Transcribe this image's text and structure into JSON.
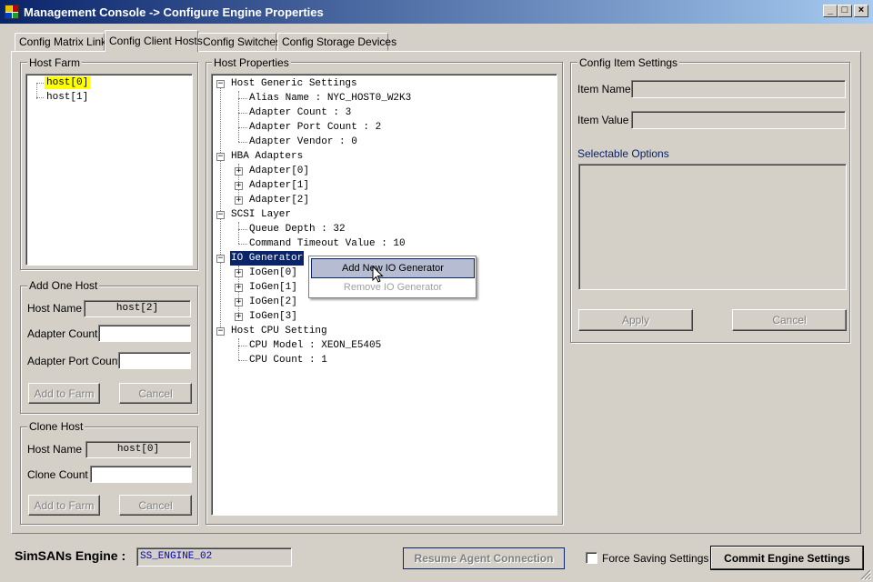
{
  "window": {
    "title": "Management Console -> Configure Engine Properties",
    "buttons": {
      "minimize": "_",
      "maximize": "□",
      "close": "×"
    }
  },
  "tabs": [
    {
      "label": "Config Matrix Links",
      "active": false
    },
    {
      "label": "Config Client Hosts",
      "active": true
    },
    {
      "label": "Config Switches",
      "active": false
    },
    {
      "label": "Config Storage Devices",
      "active": false
    }
  ],
  "host_farm": {
    "title": "Host Farm",
    "hosts": [
      "host[0]",
      "host[1]"
    ],
    "selected_index": 0,
    "highlight_color": "#ffff00"
  },
  "add_one_host": {
    "title": "Add One Host",
    "host_name_label": "Host Name",
    "host_name_value": "host[2]",
    "adapter_count_label": "Adapter Count",
    "adapter_count_value": "",
    "adapter_port_count_label": "Adapter Port Count",
    "adapter_port_count_value": "",
    "add_button": "Add to Farm",
    "cancel_button": "Cancel"
  },
  "clone_host": {
    "title": "Clone Host",
    "host_name_label": "Host Name",
    "host_name_value": "host[0]",
    "clone_count_label": "Clone Count",
    "clone_count_value": "",
    "add_button": "Add to Farm",
    "cancel_button": "Cancel"
  },
  "host_properties": {
    "title": "Host Properties",
    "generic_settings": {
      "label": "Host Generic Settings",
      "alias": "Alias Name : NYC_HOST0_W2K3",
      "adapter_count": "Adapter Count : 3",
      "adapter_port_count": "Adapter Port Count : 2",
      "adapter_vendor": "Adapter Vendor : 0"
    },
    "hba_adapters": {
      "label": "HBA Adapters",
      "items": [
        "Adapter[0]",
        "Adapter[1]",
        "Adapter[2]"
      ]
    },
    "scsi_layer": {
      "label": "SCSI Layer",
      "queue_depth": "Queue Depth : 32",
      "command_timeout": "Command Timeout Value : 10"
    },
    "io_generator": {
      "label": "IO Generator",
      "items": [
        "IoGen[0]",
        "IoGen[1]",
        "IoGen[2]",
        "IoGen[3]"
      ]
    },
    "cpu_setting": {
      "label": "Host CPU Setting",
      "cpu_model": "CPU Model : XEON_E5405",
      "cpu_count": "CPU Count : 1"
    },
    "expander_collapsed": "+",
    "expander_expanded": "−"
  },
  "context_menu": {
    "add": "Add New IO Generator",
    "remove": "Remove IO Generator"
  },
  "config_item": {
    "title": "Config Item Settings",
    "item_name_label": "Item Name",
    "item_name_value": "",
    "item_value_label": "Item Value",
    "item_value_value": "",
    "selectable_options_label": "Selectable Options",
    "apply_button": "Apply",
    "cancel_button": "Cancel"
  },
  "footer": {
    "engine_label": "SimSANs Engine :",
    "engine_value": "SS_ENGINE_02",
    "resume_button": "Resume Agent Connection",
    "force_saving_label": "Force Saving Settings",
    "force_saving_checked": false,
    "commit_button": "Commit Engine Settings"
  },
  "colors": {
    "title_bar_start": "#0a246a",
    "title_bar_end": "#a6caf0",
    "selection_navy": "#0a246a",
    "link_blue": "#0a246a",
    "engine_text": "#0000c0",
    "menu_hover": "#b6bdd2"
  },
  "icons": [
    "app-icon",
    "mouse-cursor-icon"
  ]
}
